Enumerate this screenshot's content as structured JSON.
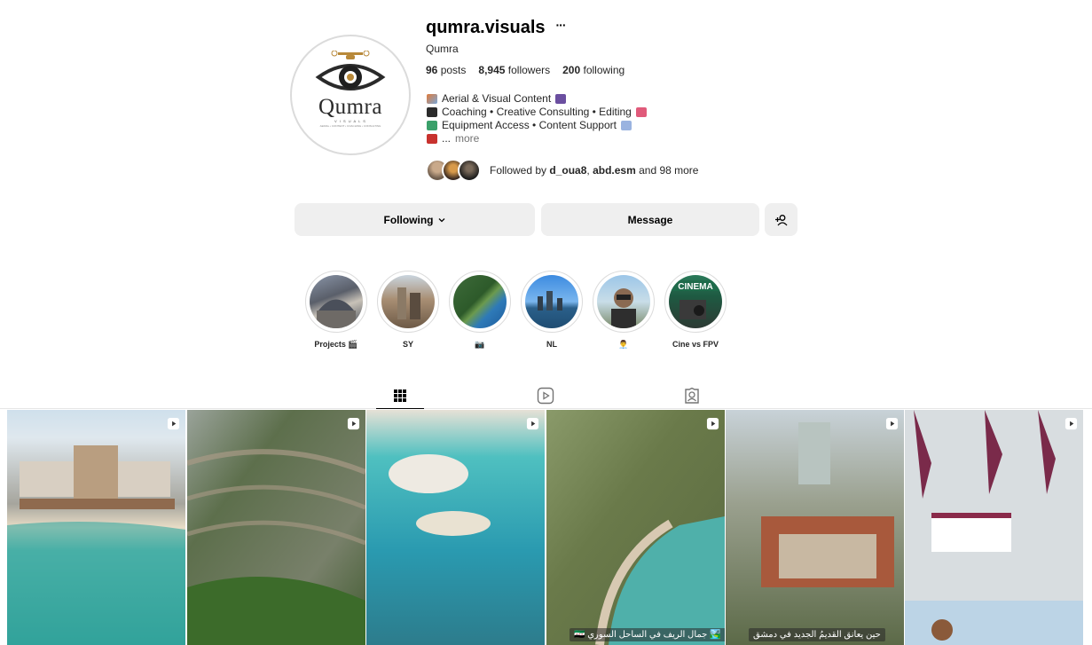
{
  "profile": {
    "username": "qumra.visuals",
    "full_name": "Qumra",
    "logo_text": "Qumra",
    "logo_subtitle": "V I S U A L S",
    "logo_tagline": "AERIAL • CONTENT • COACHING • CONSULTING",
    "stats": {
      "posts_count": "96",
      "posts_label": "posts",
      "followers_count": "8,945",
      "followers_label": "followers",
      "following_count": "200",
      "following_label": "following"
    },
    "bio": {
      "line1": "Aerial & Visual Content",
      "line2": "Coaching • Creative Consulting • Editing",
      "line3": "Equipment Access • Content Support",
      "line4_prefix": "...",
      "more": "more"
    },
    "followed_by": {
      "prefix": "Followed by",
      "user1": "d_oua8",
      "user2": "abd.esm",
      "suffix": "and 98 more"
    }
  },
  "actions": {
    "following_label": "Following",
    "message_label": "Message"
  },
  "highlights": [
    {
      "label": "Projects 🎬"
    },
    {
      "label": "SY"
    },
    {
      "label": "📷"
    },
    {
      "label": "NL"
    },
    {
      "label": "👨‍💼"
    },
    {
      "label": "Cine vs FPV"
    }
  ],
  "highlight_badge": "CINEMA",
  "posts": [
    {
      "type": "reel",
      "caption": ""
    },
    {
      "type": "reel",
      "caption": ""
    },
    {
      "type": "reel",
      "caption": ""
    },
    {
      "type": "reel",
      "caption": "🏞️ جمال الريف في الساحل السوري 🇸🇾"
    },
    {
      "type": "reel",
      "caption": "حين يعانق القديمُ الجديد في دمشق"
    },
    {
      "type": "reel",
      "caption": ""
    }
  ],
  "tabs": [
    {
      "name": "posts-grid",
      "icon": "grid-icon",
      "active": true
    },
    {
      "name": "reels",
      "icon": "reels-icon",
      "active": false
    },
    {
      "name": "tagged",
      "icon": "tagged-icon",
      "active": false
    }
  ],
  "colors": {
    "button_bg": "#efefef",
    "text": "#262626",
    "muted": "#737373",
    "divider": "#dbdbdb"
  }
}
